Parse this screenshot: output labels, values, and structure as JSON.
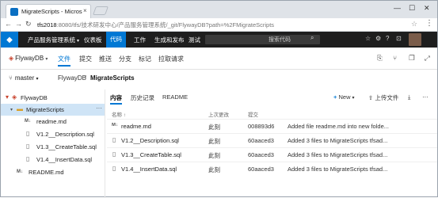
{
  "browser": {
    "tab_title": "MigrateScripts - Micros",
    "tab_close": "×",
    "url_host": "tfs2018",
    "url_path": ":8080/tfs/技术研发中心/产品服务管理系统/_git/FlywayDB?path=%2FMigrateScripts",
    "controls": {
      "minimize": "—",
      "maximize": "☐",
      "close": "✕"
    }
  },
  "topnav": {
    "logo_icon": "visual-studio-icon",
    "project": "产品服务管理系统",
    "items": [
      "仪表板",
      "代码",
      "工作",
      "生成和发布",
      "测试"
    ],
    "active_item": "代码",
    "search_placeholder": "搜索代码",
    "icons": [
      "star-icon",
      "gear-icon",
      "help-icon",
      "shopping-bag-icon"
    ]
  },
  "repobar": {
    "repo_name": "FlywayDB",
    "tabs": [
      "文件",
      "提交",
      "推送",
      "分支",
      "标记",
      "拉取请求"
    ],
    "active_tab": "文件"
  },
  "crumbs": {
    "branch": "master",
    "repo": "FlywayDB",
    "separator": "/",
    "folder": "MigrateScripts"
  },
  "tree": {
    "items": [
      {
        "label": "FlywayDB",
        "icon": "repo-icon",
        "depth": 0
      },
      {
        "label": "MigrateScripts",
        "icon": "folder-icon",
        "depth": 1,
        "selected": true
      },
      {
        "label": "readme.md",
        "icon": "markdown-file-icon",
        "depth": 2
      },
      {
        "label": "V1.2__Description.sql",
        "icon": "file-icon",
        "depth": 2
      },
      {
        "label": "V1.3__CreateTable.sql",
        "icon": "file-icon",
        "depth": 2
      },
      {
        "label": "V1.4__InsertData.sql",
        "icon": "file-icon",
        "depth": 2
      },
      {
        "label": "README.md",
        "icon": "markdown-file-icon",
        "depth": 1
      }
    ],
    "more": "···"
  },
  "content": {
    "tabs": [
      "内容",
      "历史记录",
      "README"
    ],
    "active_tab": "内容",
    "new_label": "New",
    "upload_label": "上传文件",
    "columns": {
      "name": "名称 ↑",
      "modified": "上次更改",
      "commit": "提交"
    },
    "rows": [
      {
        "name": "readme.md",
        "modified": "此刻",
        "commit": "008893d6",
        "message": "Added file readme.md into new folde..."
      },
      {
        "name": "V1.2__Description.sql",
        "modified": "此刻",
        "commit": "60aaced3",
        "message": "Added 3 files to MigrateScripts  tfsad..."
      },
      {
        "name": "V1.3__CreateTable.sql",
        "modified": "此刻",
        "commit": "60aaced3",
        "message": "Added 3 files to MigrateScripts  tfsad..."
      },
      {
        "name": "V1.4__InsertData.sql",
        "modified": "此刻",
        "commit": "60aaced3",
        "message": "Added 3 files to MigrateScripts  tfsad..."
      }
    ]
  },
  "colors": {
    "accent": "#0078d4",
    "topnav_bg": "#1e1e1e",
    "selected_bg": "#cfe4f6",
    "folder": "#d9a028",
    "repo": "#c8402a"
  }
}
